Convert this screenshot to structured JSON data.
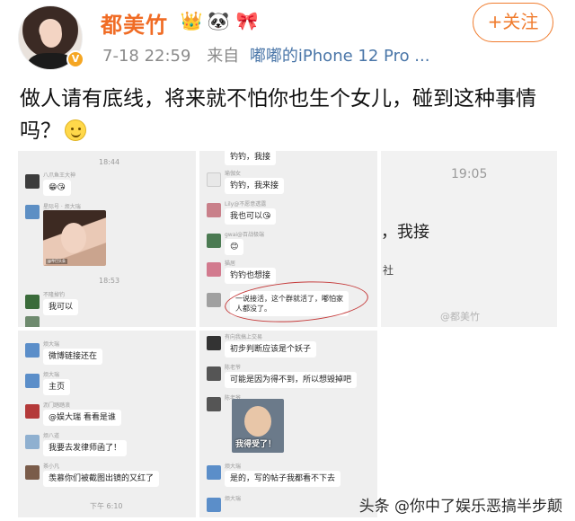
{
  "post": {
    "author": "都美竹",
    "verified_badge": "V",
    "badges": [
      "crown-icon",
      "panda-icon",
      "bow-icon"
    ],
    "date": "7-18 22:59",
    "source_prefix": "来自",
    "source": "嘟嘟的iPhone 12 Pro ...",
    "follow_label": "+关注",
    "text": "做人请有底线，将来就不怕你也生个女儿，碰到这种事情吗？"
  },
  "chat1": {
    "time1": "18:44",
    "name1": "八爪鱼王大神",
    "emoji_bubble": "😁😘",
    "name2": "星际号 · 烦大瑞",
    "photo_caption": "@今日头条",
    "time2": "18:53",
    "name3": "不隆掉钓",
    "msg3": "我可以"
  },
  "chat2": {
    "msg_top": "钓钓，我接",
    "name1": "瑜伽女",
    "msg1": "钓钓，我来接",
    "name2": "Lily@不愿意透露",
    "msg2": "我也可以😘",
    "name3": "gwai@百战极端",
    "name4": "猫居",
    "msg4": "钓钓也想接",
    "msg5_line1": "一说接活，这个群就活了，嘟怕家",
    "msg5_line2": "人都没了。"
  },
  "chat3": {
    "time": "19:05",
    "text": "，我接",
    "partial": "社",
    "watermark": "@都美竹"
  },
  "chat4": {
    "name1": "烦大瑞",
    "msg1": "微博链接还在",
    "name2": "烦大瑞",
    "msg2": "主页",
    "name3": "沥门踏踏浪",
    "msg3": "@娱大瑞 看看是谁",
    "name4": "烦八道",
    "msg4": "我要去发律师函了！",
    "name5": "茶小凡",
    "msg5": "羡慕你们被截图出镜的又红了",
    "time_bottom": "下午 6:10"
  },
  "chat5": {
    "name1": "有向我搞上交易",
    "msg1": "初步判断应该是个妖子",
    "name2": "陈老爷",
    "msg2": "可能是因为得不到，所以想毁掉吧",
    "name3": "陈老爷",
    "kid_caption": "我得受了！",
    "name4": "烦大瑞",
    "msg4": "是的，写的帖子我都看不下去",
    "name5": "烦大瑞"
  },
  "footer": "头条 @你中了娱乐恶搞半步颠"
}
